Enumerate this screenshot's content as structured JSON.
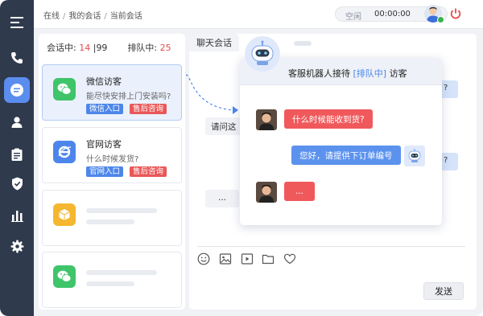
{
  "breadcrumb": {
    "items": [
      "在线",
      "我的会话",
      "当前会话"
    ],
    "sep": "/"
  },
  "status": {
    "label": "空闲",
    "timer": "00:00:00"
  },
  "counts": {
    "in_session_label": "会话中:",
    "in_session": "14",
    "divider": "|",
    "total": "99",
    "queue_label": "排队中:",
    "queue": "25"
  },
  "sessions": [
    {
      "title": "微信访客",
      "subtitle": "能尽快安排上门安装吗?",
      "tags": [
        "微信入口",
        "售后咨询"
      ]
    },
    {
      "title": "官网访客",
      "subtitle": "什么时候发货?",
      "tags": [
        "官网入口",
        "售后咨询"
      ]
    }
  ],
  "chat": {
    "tab_label": "聊天会话",
    "bg_message_1": "请问这",
    "bg_dots": "...",
    "bg_right_q1": "?",
    "bg_right_q2": "?",
    "send_label": "发送"
  },
  "overlay": {
    "title_prefix": "客服机器人接待",
    "title_tag": "[排队中]",
    "title_suffix": "访客",
    "msg1": "什么时候能收到货?",
    "msg2": "您好，请提供下订单编号",
    "msg3": "..."
  },
  "icons": {
    "menu": "menu-icon",
    "phone": "phone-icon",
    "chat": "chat-bubble-icon",
    "user": "user-icon",
    "clipboard": "clipboard-icon",
    "shield": "shield-icon",
    "chart": "bar-chart-icon",
    "settings": "gear-icon"
  },
  "colors": {
    "accent": "#5b8def",
    "sidebar": "#2f3a4d",
    "red": "#e95858",
    "blue": "#4c86ea"
  }
}
